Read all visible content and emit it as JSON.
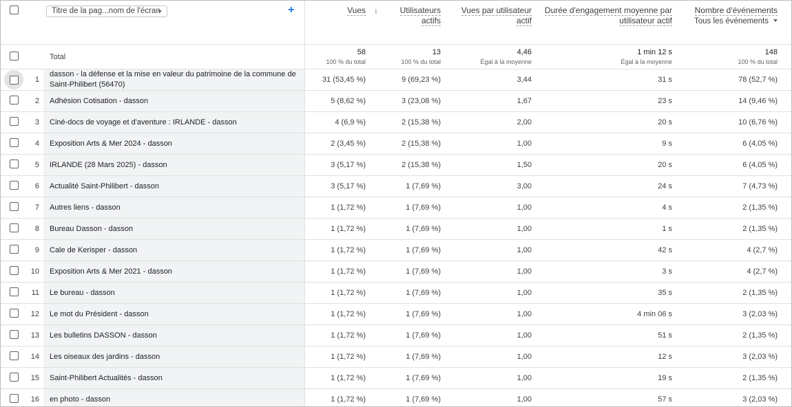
{
  "header": {
    "dimension_select": "Titre de la pag...nom de l'écran",
    "columns": [
      {
        "line1": "Vues",
        "line2": ""
      },
      {
        "line1": "Utilisateurs",
        "line2": "actifs"
      },
      {
        "line1": "Vues par utilisateur",
        "line2": "actif"
      },
      {
        "line1": "Durée d'engagement moyenne par",
        "line2": "utilisateur actif"
      },
      {
        "line1": "Nombre d'événements",
        "line2": ""
      }
    ],
    "events_filter": "Tous les événements"
  },
  "totals": {
    "label": "Total",
    "values": [
      {
        "value": "58",
        "sub": "100 % du total"
      },
      {
        "value": "13",
        "sub": "100 % du total"
      },
      {
        "value": "4,46",
        "sub": "Égal à la moyenne"
      },
      {
        "value": "1 min 12 s",
        "sub": "Égal à la moyenne"
      },
      {
        "value": "148",
        "sub": "100 % du total"
      }
    ]
  },
  "rows": [
    {
      "idx": "1",
      "title": "dasson - la défense et la mise en valeur du patrimoine de la commune de Saint-Philibert (56470)",
      "views": "31 (53,45 %)",
      "users": "9 (69,23 %)",
      "vpu": "3,44",
      "engagement": "31 s",
      "events": "78 (52,7 %)"
    },
    {
      "idx": "2",
      "title": "Adhésion Cotisation - dasson",
      "views": "5 (8,62 %)",
      "users": "3 (23,08 %)",
      "vpu": "1,67",
      "engagement": "23 s",
      "events": "14 (9,46 %)"
    },
    {
      "idx": "3",
      "title": "Ciné-docs de voyage et d'aventure : IRLANDE - dasson",
      "views": "4 (6,9 %)",
      "users": "2 (15,38 %)",
      "vpu": "2,00",
      "engagement": "20 s",
      "events": "10 (6,76 %)"
    },
    {
      "idx": "4",
      "title": "Exposition Arts & Mer 2024 - dasson",
      "views": "2 (3,45 %)",
      "users": "2 (15,38 %)",
      "vpu": "1,00",
      "engagement": "9 s",
      "events": "6 (4,05 %)"
    },
    {
      "idx": "5",
      "title": "IRLANDE (28 Mars 2025) - dasson",
      "views": "3 (5,17 %)",
      "users": "2 (15,38 %)",
      "vpu": "1,50",
      "engagement": "20 s",
      "events": "6 (4,05 %)"
    },
    {
      "idx": "6",
      "title": "Actualité Saint-Philibert - dasson",
      "views": "3 (5,17 %)",
      "users": "1 (7,69 %)",
      "vpu": "3,00",
      "engagement": "24 s",
      "events": "7 (4,73 %)"
    },
    {
      "idx": "7",
      "title": "Autres liens - dasson",
      "views": "1 (1,72 %)",
      "users": "1 (7,69 %)",
      "vpu": "1,00",
      "engagement": "4 s",
      "events": "2 (1,35 %)"
    },
    {
      "idx": "8",
      "title": "Bureau Dasson - dasson",
      "views": "1 (1,72 %)",
      "users": "1 (7,69 %)",
      "vpu": "1,00",
      "engagement": "1 s",
      "events": "2 (1,35 %)"
    },
    {
      "idx": "9",
      "title": "Cale de Kerisper - dasson",
      "views": "1 (1,72 %)",
      "users": "1 (7,69 %)",
      "vpu": "1,00",
      "engagement": "42 s",
      "events": "4 (2,7 %)"
    },
    {
      "idx": "10",
      "title": "Exposition Arts & Mer 2021 - dasson",
      "views": "1 (1,72 %)",
      "users": "1 (7,69 %)",
      "vpu": "1,00",
      "engagement": "3 s",
      "events": "4 (2,7 %)"
    },
    {
      "idx": "11",
      "title": "Le bureau - dasson",
      "views": "1 (1,72 %)",
      "users": "1 (7,69 %)",
      "vpu": "1,00",
      "engagement": "35 s",
      "events": "2 (1,35 %)"
    },
    {
      "idx": "12",
      "title": "Le mot du Président - dasson",
      "views": "1 (1,72 %)",
      "users": "1 (7,69 %)",
      "vpu": "1,00",
      "engagement": "4 min 06 s",
      "events": "3 (2,03 %)"
    },
    {
      "idx": "13",
      "title": "Les bulletins DASSON - dasson",
      "views": "1 (1,72 %)",
      "users": "1 (7,69 %)",
      "vpu": "1,00",
      "engagement": "51 s",
      "events": "2 (1,35 %)"
    },
    {
      "idx": "14",
      "title": "Les oiseaux des jardins - dasson",
      "views": "1 (1,72 %)",
      "users": "1 (7,69 %)",
      "vpu": "1,00",
      "engagement": "12 s",
      "events": "3 (2,03 %)"
    },
    {
      "idx": "15",
      "title": "Saint-Philibert Actualités - dasson",
      "views": "1 (1,72 %)",
      "users": "1 (7,69 %)",
      "vpu": "1,00",
      "engagement": "19 s",
      "events": "2 (1,35 %)"
    },
    {
      "idx": "16",
      "title": "en photo - dasson",
      "views": "1 (1,72 %)",
      "users": "1 (7,69 %)",
      "vpu": "1,00",
      "engagement": "57 s",
      "events": "3 (2,03 %)"
    }
  ]
}
